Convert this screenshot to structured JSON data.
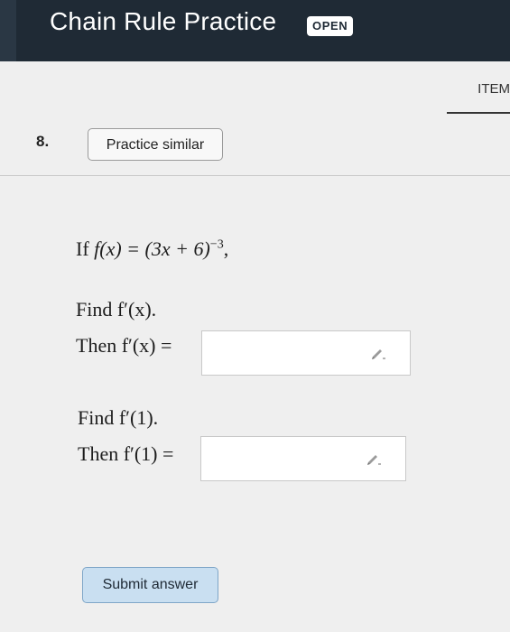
{
  "header": {
    "title": "Chain Rule Practice",
    "badge": "OPEN"
  },
  "tabs": {
    "items_label": "ITEM"
  },
  "question": {
    "number": "8.",
    "practice_button": "Practice similar",
    "prompt_prefix": "If",
    "function_lhs": "f(x) = (3x + 6)",
    "exponent": "−3",
    "prompt_suffix": ",",
    "part1": {
      "find": "Find f′(x).",
      "then": "Then f′(x) =",
      "value": ""
    },
    "part2": {
      "find": "Find f′(1).",
      "then": "Then f′(1) =",
      "value": ""
    },
    "pencil_icon": "pencil-icon"
  },
  "submit": {
    "label": "Submit answer"
  }
}
